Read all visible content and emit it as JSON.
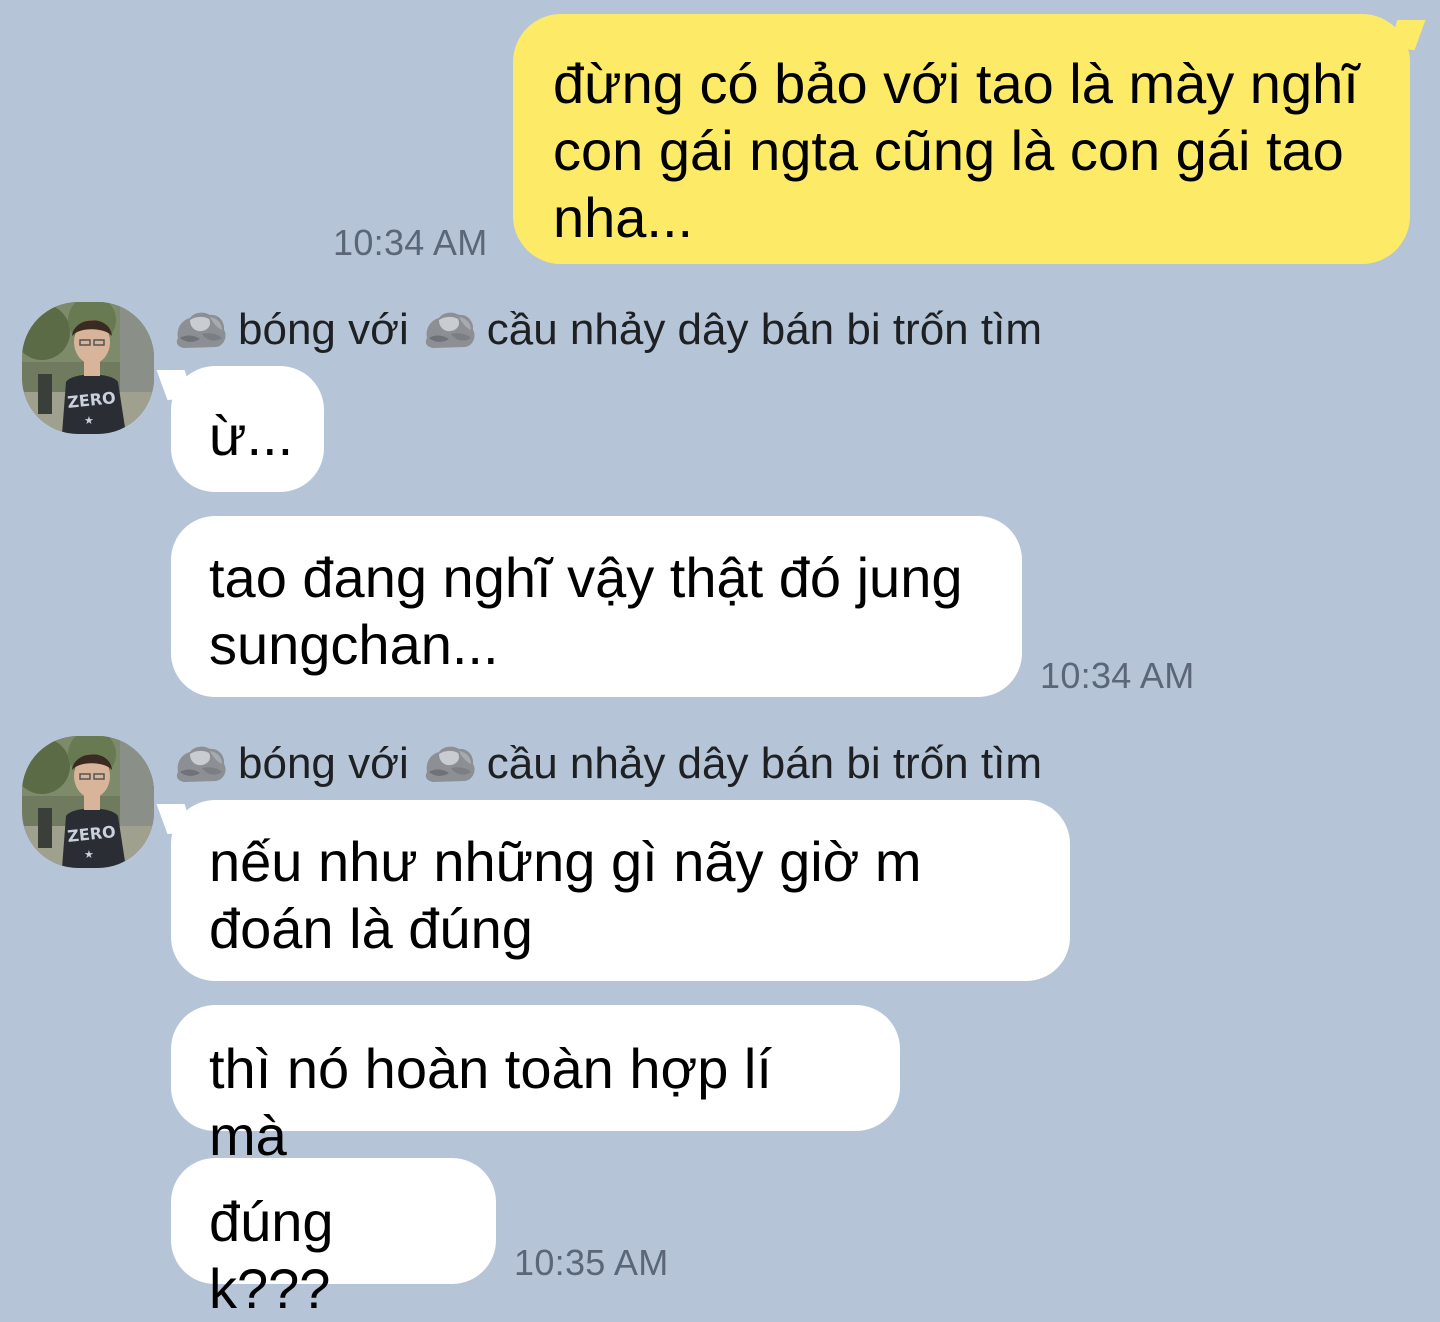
{
  "colors": {
    "background": "#b5c5d7",
    "outgoing_bubble": "#fdeb67",
    "incoming_bubble": "#ffffff",
    "timestamp": "#5b6676"
  },
  "messages": {
    "outgoing": {
      "text": "đừng có bảo với tao là mày nghĩ\ncon gái ngta cũng là con gái tao\nnha...",
      "time": "10:34 AM"
    },
    "group1": {
      "sender_part1": "bóng với",
      "sender_part2": "cầu nhảy dây bán bi trốn tìm",
      "sender_icon": "rock-icon",
      "bubbles": [
        {
          "text": "ừ..."
        },
        {
          "text": "tao đang nghĩ vậy thật đó jung\nsungchan..."
        }
      ],
      "time": "10:34 AM"
    },
    "group2": {
      "sender_part1": "bóng với",
      "sender_part2": "cầu nhảy dây bán bi trốn tìm",
      "sender_icon": "rock-icon",
      "bubbles": [
        {
          "text": "nếu như những gì nãy giờ m\nđoán là đúng"
        },
        {
          "text": "thì nó hoàn toàn hợp lí mà"
        },
        {
          "text": "đúng k???"
        }
      ],
      "time": "10:35 AM"
    }
  }
}
